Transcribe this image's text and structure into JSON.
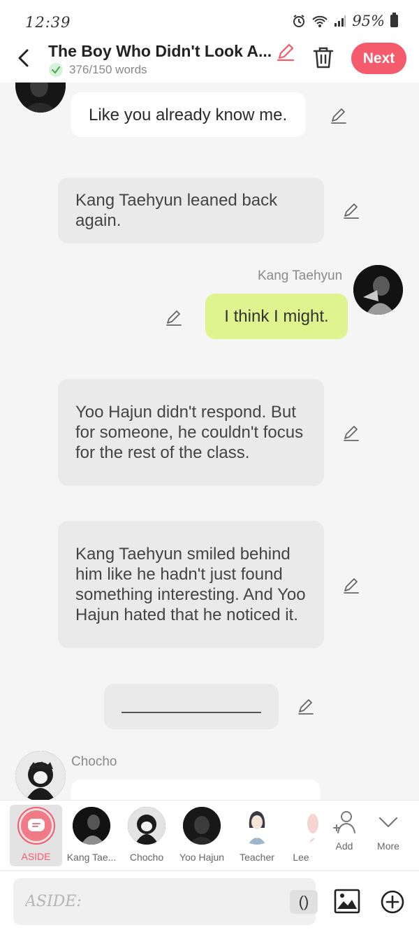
{
  "status": {
    "time": "12:39",
    "battery": "95%"
  },
  "header": {
    "title": "The Boy Who Didn't Look A...",
    "word_count": "376/150 words",
    "next_label": "Next"
  },
  "messages": [
    {
      "type": "char",
      "text": "Like you already know me."
    },
    {
      "type": "narration",
      "text": "Kang Taehyun leaned back again."
    },
    {
      "type": "self",
      "speaker": "Kang Taehyun",
      "text": "I think I might."
    },
    {
      "type": "narration",
      "text": "Yoo Hajun didn't respond. But for someone, he couldn't focus for the rest of the class."
    },
    {
      "type": "narration",
      "text": "Kang Taehyun smiled behind him like he hadn't just found something interesting. And Yoo Hajun hated that he noticed it."
    },
    {
      "type": "divider"
    },
    {
      "type": "char",
      "speaker": "Chocho",
      "text": ""
    }
  ],
  "characters": [
    {
      "label": "ASIDE",
      "selected": true
    },
    {
      "label": "Kang Tae..."
    },
    {
      "label": "Chocho"
    },
    {
      "label": "Yoo Hajun"
    },
    {
      "label": "Teacher"
    },
    {
      "label": "Lee"
    },
    {
      "label": "Add",
      "icon": "add-person-icon"
    },
    {
      "label": "More",
      "icon": "chevron-down-icon"
    }
  ],
  "input": {
    "placeholder": "ASIDE:",
    "paren_label": "()"
  },
  "colors": {
    "accent": "#f45b6d",
    "self_bubble": "#dff48f",
    "narration_bubble": "#eaeaea",
    "char_bubble": "#ffffff"
  }
}
